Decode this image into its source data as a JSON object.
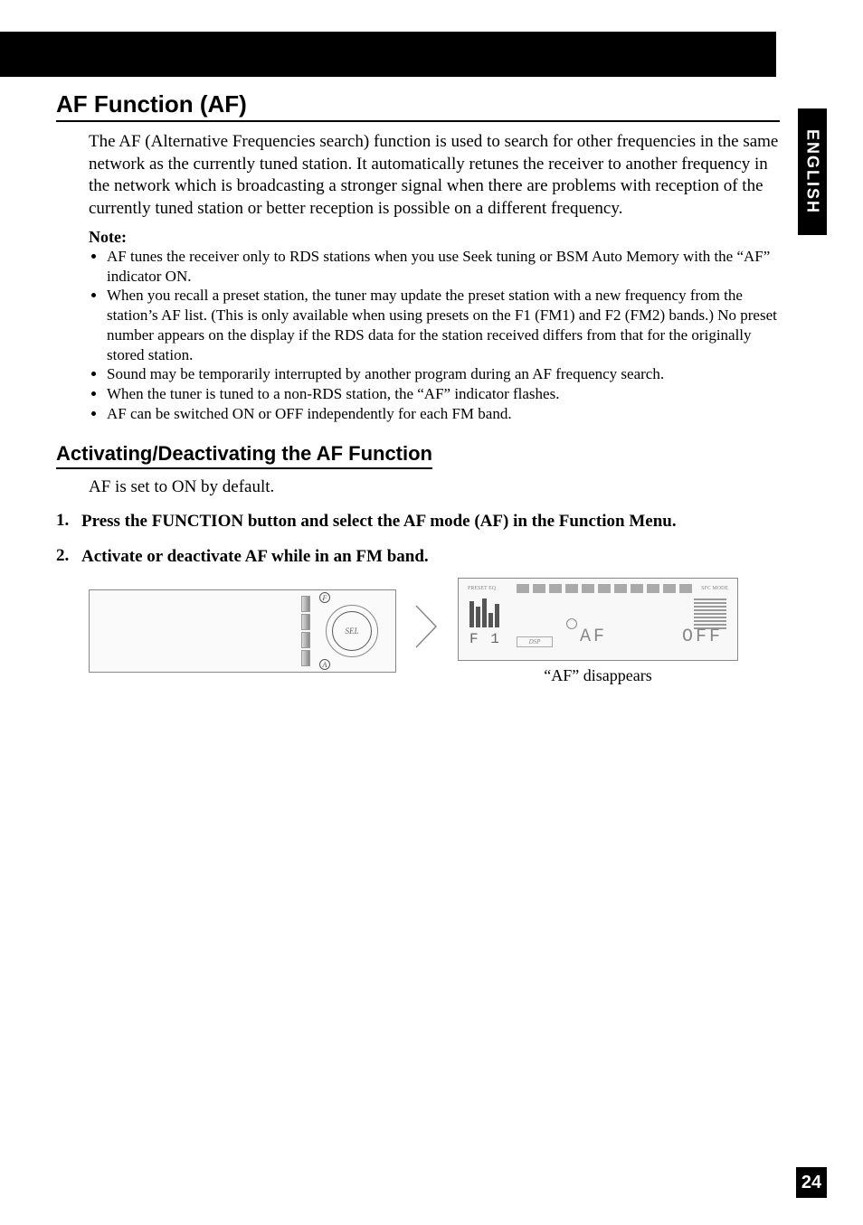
{
  "side_tab": "ENGLISH",
  "page_number": "24",
  "heading": "AF Function (AF)",
  "intro": "The AF (Alternative Frequencies search) function is used to search for other frequencies in the same network as the currently tuned station. It automatically retunes the receiver to another frequency in the network which is broadcasting a stronger signal when there are problems with reception of the currently tuned station or better reception is possible on a different frequency.",
  "note_label": "Note:",
  "notes": [
    "AF tunes the receiver only to RDS stations when you use Seek tuning or BSM Auto Memory with the “AF” indicator ON.",
    "When you recall a preset station, the tuner may update the preset station with a new frequency from the station’s AF list. (This is only available when using presets on the F1 (FM1) and F2 (FM2) bands.) No preset number appears on the display if the RDS data for the station received differs from that for the originally stored station.",
    "Sound may be temporarily interrupted by another program during an AF frequency search.",
    "When the tuner is tuned to a non-RDS station, the “AF” indicator flashes.",
    "AF can be switched ON or OFF independently for each FM band."
  ],
  "sub_heading": "Activating/Deactivating the AF Function",
  "sub_intro": "AF is set to ON by default.",
  "steps": [
    {
      "num": "1.",
      "text": "Press the FUNCTION button and select the AF mode (AF) in the Function Menu."
    },
    {
      "num": "2.",
      "text": "Activate or deactivate AF while in an FM band."
    }
  ],
  "device": {
    "knob_label": "SEL",
    "f_label": "F",
    "a_label": "A"
  },
  "display": {
    "preset": "PRESET EQ",
    "sfc": "SFC MODE",
    "band": "F 1",
    "dsp": "DSP",
    "af": "AF",
    "off": "OFF"
  },
  "caption": "“AF” disappears"
}
